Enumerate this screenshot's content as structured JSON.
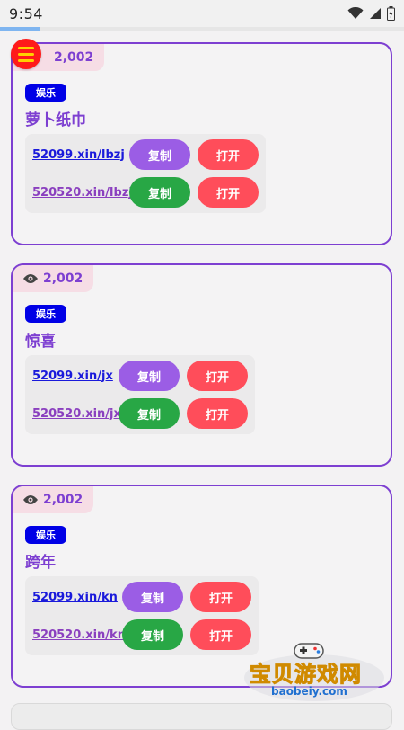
{
  "status_bar": {
    "time": "9:54"
  },
  "progress": 0.1,
  "cards": [
    {
      "views": "2,002",
      "category": "娱乐",
      "title": "萝卜纸巾",
      "links": [
        {
          "url": "52099.xin/lbzj",
          "copy_label": "复制",
          "open_label": "打开"
        },
        {
          "url": "520520.xin/lbzj",
          "copy_label": "复制",
          "open_label": "打开"
        }
      ]
    },
    {
      "views": "2,002",
      "category": "娱乐",
      "title": "惊喜",
      "links": [
        {
          "url": "52099.xin/jx",
          "copy_label": "复制",
          "open_label": "打开"
        },
        {
          "url": "520520.xin/jx",
          "copy_label": "复制",
          "open_label": "打开"
        }
      ]
    },
    {
      "views": "2,002",
      "category": "娱乐",
      "title": "跨年",
      "links": [
        {
          "url": "52099.xin/kn",
          "copy_label": "复制",
          "open_label": "打开"
        },
        {
          "url": "520520.xin/kn",
          "copy_label": "复制",
          "open_label": "打开"
        }
      ]
    }
  ],
  "watermark": {
    "title": "宝贝游戏网",
    "site": "baobeiy.com"
  },
  "colors": {
    "accent": "#7d3fd1",
    "copy_purple": "#9b5de5",
    "copy_green": "#28a745",
    "open_red": "#ff4d5a",
    "tag_blue": "#0000e6",
    "menu_red": "#ff1a1a"
  },
  "icons": {
    "menu": "hamburger-menu-icon",
    "views": "eye-icon",
    "wifi": "wifi-icon",
    "signal": "signal-icon",
    "battery": "battery-icon"
  }
}
